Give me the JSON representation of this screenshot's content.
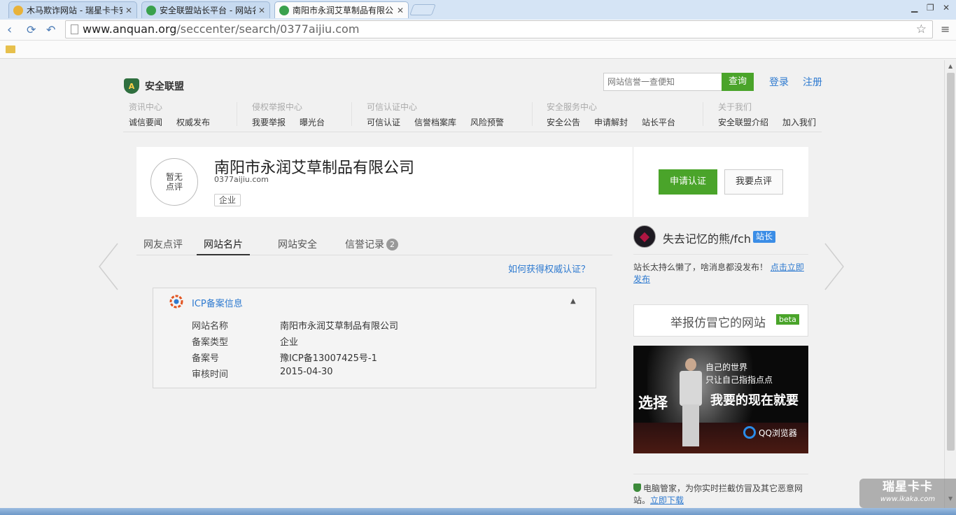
{
  "browser": {
    "tabs": [
      {
        "title": "木马欺诈网站 - 瑞星卡卡安",
        "color": "#e8b23a"
      },
      {
        "title": "安全联盟站长平台 - 网站名",
        "color": "#3aa14d"
      },
      {
        "title": "南阳市永润艾草制品有限公",
        "color": "#3aa14d"
      }
    ],
    "url_host": "www.anquan.org",
    "url_path": "/seccenter/search/0377aijiu.com"
  },
  "site": {
    "logo_text": "安全联盟",
    "search_placeholder": "网站信誉一查便知",
    "search_button": "查询",
    "login": "登录",
    "register": "注册",
    "nav": [
      {
        "title": "资讯中心",
        "items": [
          "诚信要闻",
          "权威发布"
        ]
      },
      {
        "title": "侵权举报中心",
        "items": [
          "我要举报",
          "曝光台"
        ]
      },
      {
        "title": "可信认证中心",
        "items": [
          "可信认证",
          "信誉档案库",
          "风险预警"
        ]
      },
      {
        "title": "安全服务中心",
        "items": [
          "安全公告",
          "申请解封",
          "站长平台"
        ]
      },
      {
        "title": "关于我们",
        "items": [
          "安全联盟介绍",
          "加入我们"
        ]
      }
    ]
  },
  "profile": {
    "rating_line1": "暂无",
    "rating_line2": "点评",
    "company": "南阳市永润艾草制品有限公司",
    "domain": "0377aijiu.com",
    "type_tag": "企业",
    "apply_button": "申请认证",
    "review_button": "我要点评"
  },
  "tabs": {
    "items": [
      "网友点评",
      "网站名片",
      "网站安全",
      "信誉记录"
    ],
    "active": 1,
    "badge": "2"
  },
  "how_link": "如何获得权威认证？",
  "icp": {
    "title": "ICP备案信息",
    "rows": [
      {
        "k": "网站名称",
        "v": "南阳市永润艾草制品有限公司"
      },
      {
        "k": "备案类型",
        "v": "企业"
      },
      {
        "k": "备案号",
        "v": "豫ICP备13007425号-1"
      },
      {
        "k": "审核时间",
        "v": "2015-04-30"
      }
    ]
  },
  "sidebar": {
    "admin_name": "失去记忆的熊/fch",
    "admin_badge": "站长",
    "admin_msg": "站长太持么懒了，啥消息都没发布！",
    "admin_link": "点击立即发布",
    "report_text": "举报仿冒它的网站",
    "report_badge": "beta",
    "ad_line1": "自己的世界",
    "ad_line2": "只让自己指指点点",
    "ad_line3": "选择",
    "ad_line4": "我要的现在就要",
    "ad_brand": "QQ浏览器",
    "guard_text": "电脑管家，为你实时拦截仿冒及其它恶意网站。",
    "guard_link": "立即下载"
  },
  "watermark": {
    "line1": "瑞星卡卡",
    "line2": "www.ikaka.com"
  }
}
